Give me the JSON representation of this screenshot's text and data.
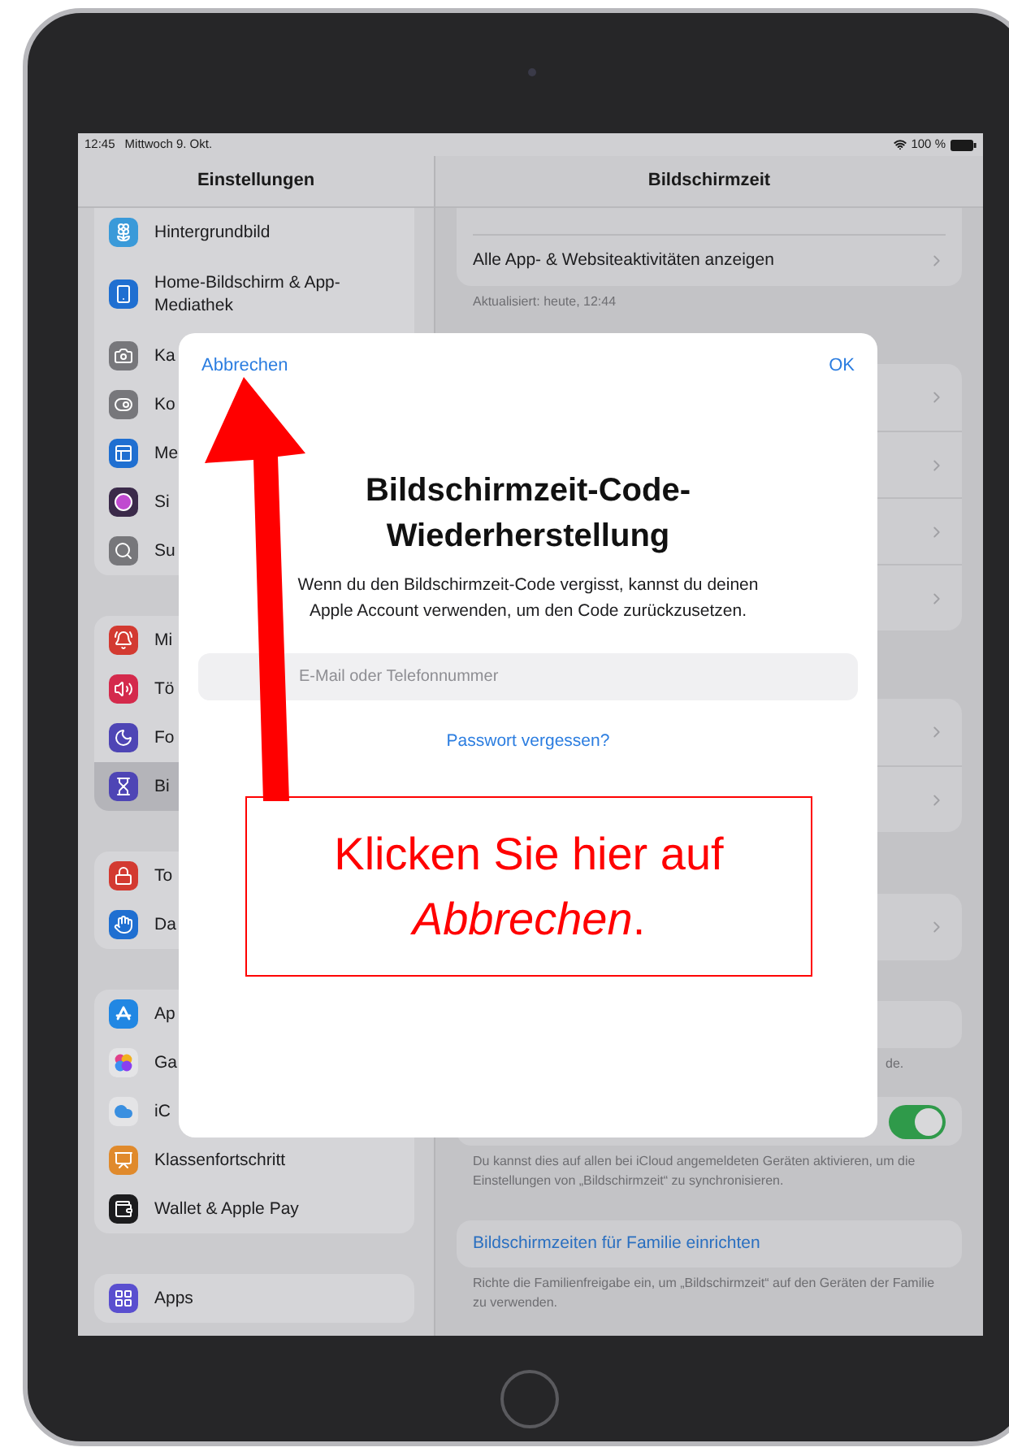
{
  "status_bar": {
    "time": "12:45",
    "date": "Mittwoch 9. Okt.",
    "battery": "100 %"
  },
  "sidebar": {
    "title": "Einstellungen",
    "groups": [
      {
        "items": [
          {
            "label": "Hintergrundbild",
            "color": "#3a9ad9",
            "selected": false
          },
          {
            "label": "Home-Bildschirm & App-Mediathek",
            "color": "#1f6fd1",
            "selected": false
          },
          {
            "label": "Ka",
            "color": "#77777b",
            "selected": false
          },
          {
            "label": "Ko",
            "color": "#77777b",
            "selected": false
          },
          {
            "label": "Me",
            "color": "#1f6fd1",
            "selected": false
          },
          {
            "label": "Si",
            "color": "#3b2a4a",
            "selected": false
          },
          {
            "label": "Su",
            "color": "#77777b",
            "selected": false
          }
        ]
      },
      {
        "items": [
          {
            "label": "Mi",
            "color": "#d33a31",
            "selected": false
          },
          {
            "label": "Tö",
            "color": "#d42a4c",
            "selected": false
          },
          {
            "label": "Fo",
            "color": "#4e45b5",
            "selected": false
          },
          {
            "label": "Bi",
            "color": "#4e45b5",
            "selected": true
          }
        ]
      },
      {
        "items": [
          {
            "label": "To",
            "color": "#d33a31",
            "selected": false
          },
          {
            "label": "Da",
            "color": "#1f6fd1",
            "selected": false
          }
        ]
      },
      {
        "items": [
          {
            "label": "Ap",
            "color": "#2187e3",
            "selected": false
          },
          {
            "label": "Ga",
            "color": "#e4e4e6",
            "selected": false
          },
          {
            "label": "iC",
            "color": "#e4e4e6",
            "selected": false
          },
          {
            "label": "Klassenfortschritt",
            "color": "#e08a2c",
            "selected": false
          },
          {
            "label": "Wallet & Apple Pay",
            "color": "#1c1c1e",
            "selected": false
          }
        ]
      },
      {
        "items": [
          {
            "label": "Apps",
            "color": "#5a4fcf",
            "selected": false
          }
        ]
      }
    ]
  },
  "detail": {
    "title": "Bildschirmzeit",
    "sections": [
      {
        "rows": [
          {
            "kind": "chevron",
            "label": "Alle App- & Websiteaktivitäten anzeigen"
          }
        ],
        "footer": "Aktualisiert: heute, 12:44"
      },
      {
        "rows": [
          {
            "kind": "chevron"
          },
          {
            "kind": "chevron"
          },
          {
            "kind": "chevron"
          },
          {
            "kind": "chevron"
          }
        ]
      },
      {
        "rows": [
          {
            "kind": "chevron"
          },
          {
            "kind": "chevron"
          }
        ]
      },
      {
        "rows": [
          {
            "kind": "chevron"
          }
        ]
      },
      {
        "rows": [
          {
            "kind": "plain"
          }
        ],
        "footer": "de."
      },
      {
        "rows": [
          {
            "kind": "toggle",
            "on": true
          }
        ],
        "footer": "Du kannst dies auf allen bei iCloud angemeldeten Geräten aktivieren, um die Einstellungen von „Bildschirmzeit“ zu synchronisieren."
      },
      {
        "rows": [
          {
            "kind": "link",
            "label": "Bildschirmzeiten für Familie einrichten"
          }
        ],
        "footer": "Richte die Familienfreigabe ein, um „Bildschirmzeit“ auf den Geräten der Familie zu verwenden."
      }
    ]
  },
  "dialog": {
    "cancel": "Abbrechen",
    "ok": "OK",
    "title": "Bildschirmzeit-Code-Wiederherstellung",
    "message": "Wenn du den Bildschirmzeit-Code vergisst, kannst du deinen Apple Account verwenden, um den Code zurückzusetzen.",
    "field": {
      "placeholder": "E-Mail oder Telefonnummer"
    },
    "link": "Passwort vergessen?"
  },
  "annotation": {
    "text": "Klicken Sie hier auf *Abbrechen*."
  }
}
